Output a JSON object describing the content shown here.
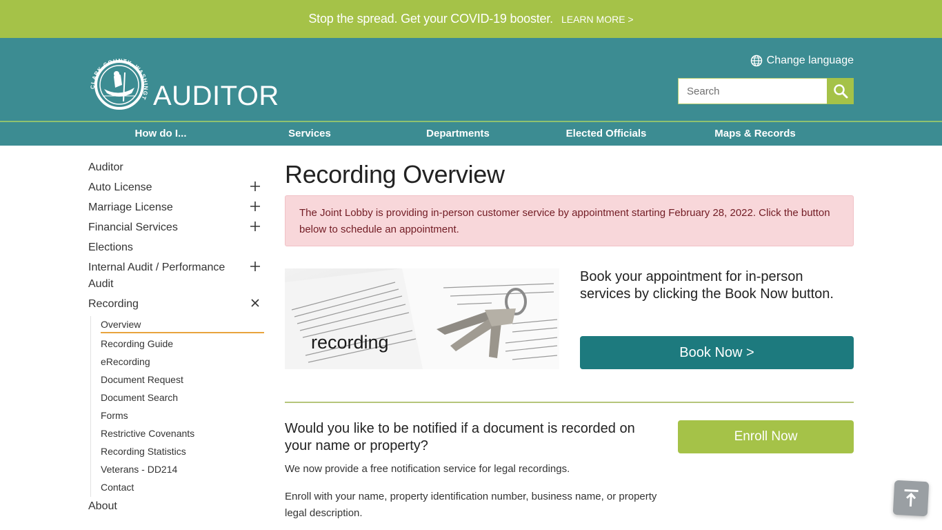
{
  "banner": {
    "message": "Stop the spread. Get your COVID-19 booster.",
    "link_label": "LEARN MORE >"
  },
  "header": {
    "logo_text": "CLARK COUNTY, WASHINGTON",
    "site_title": "AUDITOR",
    "change_language": "Change language",
    "search_placeholder": "Search"
  },
  "nav": {
    "items": [
      {
        "label": "How do I..."
      },
      {
        "label": "Services"
      },
      {
        "label": "Departments"
      },
      {
        "label": "Elected Officials"
      },
      {
        "label": "Maps & Records"
      }
    ]
  },
  "sidebar": {
    "items": [
      {
        "label": "Auditor",
        "toggle": "none"
      },
      {
        "label": "Auto License",
        "toggle": "plus"
      },
      {
        "label": "Marriage License",
        "toggle": "plus"
      },
      {
        "label": "Financial Services",
        "toggle": "plus"
      },
      {
        "label": "Elections",
        "toggle": "none"
      },
      {
        "label": "Internal Audit / Performance Audit",
        "toggle": "plus"
      },
      {
        "label": "Recording",
        "toggle": "close"
      },
      {
        "label": "About",
        "toggle": "none"
      }
    ],
    "recording_subitems": [
      {
        "label": "Overview",
        "active": true
      },
      {
        "label": "Recording Guide"
      },
      {
        "label": "eRecording"
      },
      {
        "label": "Document Request"
      },
      {
        "label": "Document Search"
      },
      {
        "label": "Forms"
      },
      {
        "label": "Restrictive Covenants"
      },
      {
        "label": "Recording Statistics"
      },
      {
        "label": "Veterans - DD214"
      },
      {
        "label": "Contact"
      }
    ]
  },
  "main": {
    "title": "Recording Overview",
    "alert": "The Joint Lobby is providing in-person customer service by appointment starting February 28, 2022. Click the button below to schedule an appointment.",
    "image_caption": "recording",
    "book_text": "Book your appointment for in-person services by clicking the Book Now button.",
    "book_button": "Book Now >",
    "notify_title": "Would you like to be notified if a document is recorded on your name or property?",
    "notify_p1": "We now provide a free notification service for legal recordings.",
    "notify_p2": "Enroll with your name,  property identification number, business name, or property legal description.",
    "enroll_button": "Enroll Now"
  },
  "colors": {
    "banner_green": "#a5c248",
    "header_teal": "#3c8c92",
    "button_teal": "#1d7a7e",
    "alert_bg": "#f8d7da",
    "active_underline": "#e8a33d"
  }
}
